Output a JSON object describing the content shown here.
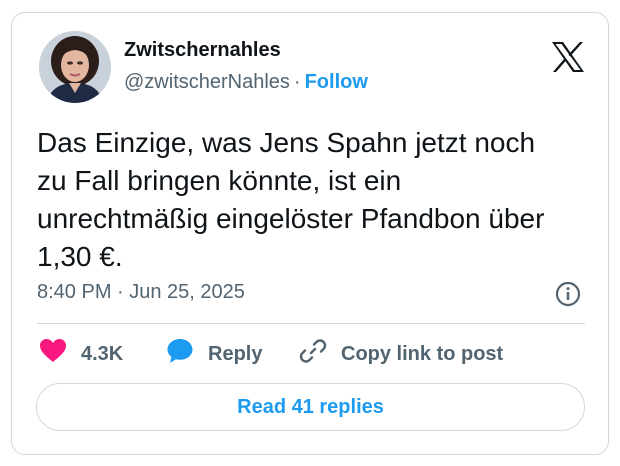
{
  "author": {
    "display_name": "Zwitschernahles",
    "handle": "@zwitscherNahles",
    "separator": "·",
    "follow_label": "Follow"
  },
  "tweet": {
    "text": "Das Einzige, was Jens Spahn jetzt noch\nzu Fall bringen könnte, ist ein\nunrechtmäßig eingelöster Pfandbon über\n1,30 €.",
    "timestamp": "8:40 PM · Jun 25, 2025"
  },
  "actions": {
    "like_count": "4.3K",
    "reply_label": "Reply",
    "copy_link_label": "Copy link to post"
  },
  "read_replies_label": "Read 41 replies",
  "icons": {
    "brand": "x-logo-icon",
    "info": "info-icon",
    "like": "heart-icon",
    "reply": "speech-bubble-icon",
    "copy": "link-icon"
  },
  "colors": {
    "accent": "#1d9bf0",
    "like": "#f91880",
    "muted": "#536471",
    "text": "#0f1419",
    "border": "#cfd9de"
  }
}
